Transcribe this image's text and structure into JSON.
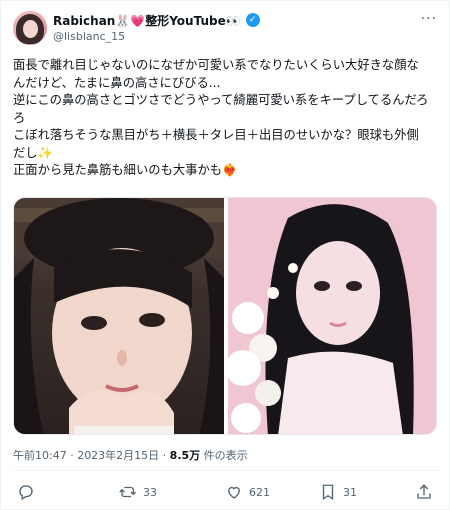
{
  "user": {
    "display_name": "Rabichan🐰💗整形YouTube👀",
    "handle": "@lisblanc_15"
  },
  "tweet": {
    "lines": [
      "面長で離れ目じゃないのになぜか可愛い系でなりたいくらい大好きな顔な",
      "んだけど、たまに鼻の高さにびびる...",
      "逆にこの鼻の高さとゴツさでどうやって綺麗可愛い系をキープしてるんだろ",
      "ろ",
      "こぼれ落ちそうな黒目がち＋横長＋タレ目＋出目のせいかな？眼球も外側",
      "だし✨",
      "正面から見た鼻筋も細いのも大事かも❤️‍🔥"
    ]
  },
  "meta": {
    "time": "午前10:47 · 2023年2月15日 · ",
    "views": "8.5万",
    "views_suffix": " 件の表示"
  },
  "actions": {
    "retweets": "33",
    "likes": "621",
    "bookmarks": "31"
  }
}
